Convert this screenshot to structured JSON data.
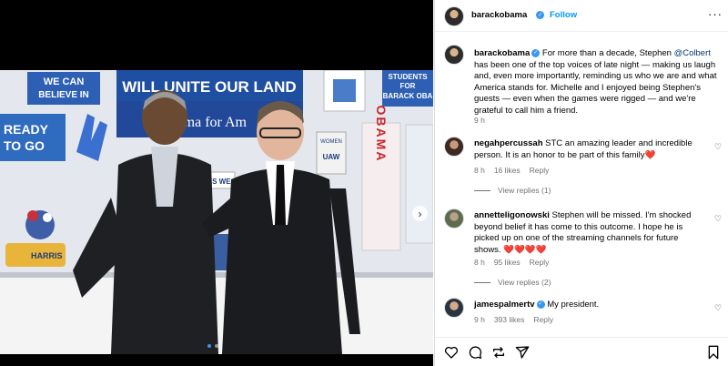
{
  "post": {
    "username": "barackobama",
    "follow_label": "Follow",
    "more_label": "···",
    "caption_text": "For more than a decade, Stephen",
    "caption_mention": "@Colbert",
    "caption_rest": "has been one of the top voices of late night — making us laugh and, even more importantly, reminding us who we are and what America stands for. Michelle and I enjoyed being Stephen's guests — even when the games were rigged — and we're grateful to call him a friend.",
    "caption_time": "9 h"
  },
  "photo_signs": {
    "we_can": "WE CAN",
    "believe_in": "BELIEVE IN",
    "will_unite": "WILL UNITE OUR LAND",
    "ready": "READY",
    "to_go": "TO GO",
    "obama_for": "Obama for Am",
    "obama": "OBAMA",
    "students": "STUDENTS",
    "for_barack": "FOR",
    "barack_oba": "BARACK OBA",
    "women": "WOMEN",
    "uaw": "UAW",
    "yes_we": "YES WE",
    "harris": "HARRIS"
  },
  "comments": [
    {
      "username": "negahpercussah",
      "text": "STC an amazing leader and incredible person. It is an honor to be part of this family",
      "emoji": "❤️",
      "time": "8 h",
      "likes": "16 likes",
      "reply": "Reply",
      "view_replies": "View replies (1)"
    },
    {
      "username": "annetteligonowski",
      "text": "Stephen will be missed. I'm shocked beyond belief it has come to this outcome. I hope he is picked up on one of the streaming channels for future shows.",
      "emoji": "❤️❤️❤️❤️",
      "time": "8 h",
      "likes": "95 likes",
      "reply": "Reply",
      "view_replies": "View replies (2)"
    },
    {
      "username": "jamespalmertv",
      "text": "My president.",
      "time": "9 h",
      "likes": "393 likes",
      "reply": "Reply"
    }
  ],
  "icons": {
    "heart": "heart-icon",
    "comment": "comment-icon",
    "share": "share-icon",
    "save": "bookmark-icon",
    "verified": "verified-badge-icon"
  },
  "colors": {
    "link": "#0095f6",
    "verified": "#3897f0",
    "muted": "#737373"
  }
}
